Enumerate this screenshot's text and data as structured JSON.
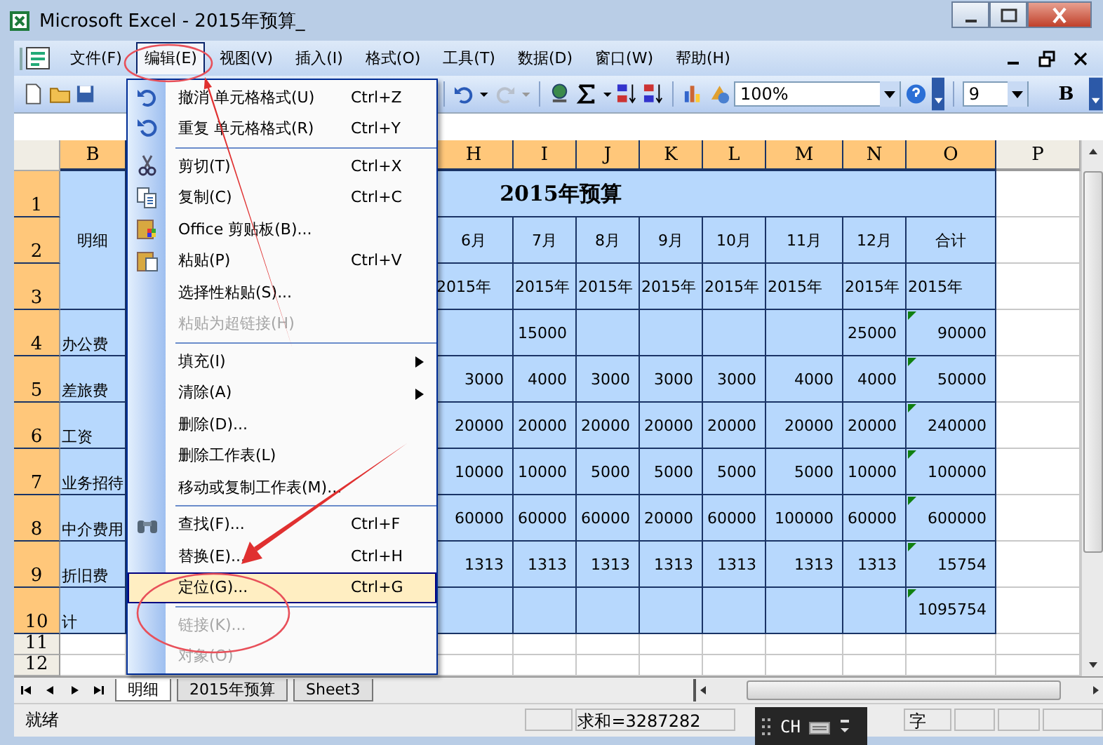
{
  "window": {
    "title": "Microsoft Excel - 2015年预算_"
  },
  "menu_bar": [
    {
      "label": "文件(F)",
      "selected": false
    },
    {
      "label": "编辑(E)",
      "selected": true
    },
    {
      "label": "视图(V)",
      "selected": false
    },
    {
      "label": "插入(I)",
      "selected": false
    },
    {
      "label": "格式(O)",
      "selected": false
    },
    {
      "label": "工具(T)",
      "selected": false
    },
    {
      "label": "数据(D)",
      "selected": false
    },
    {
      "label": "窗口(W)",
      "selected": false
    },
    {
      "label": "帮助(H)",
      "selected": false
    }
  ],
  "toolbar": {
    "zoom": "100%",
    "font_size": "9",
    "bold_label": "B",
    "redo_disabled": true
  },
  "columns": [
    {
      "label": "B",
      "selected": true
    },
    {
      "label": "H",
      "selected": true
    },
    {
      "label": "I",
      "selected": true
    },
    {
      "label": "J",
      "selected": true
    },
    {
      "label": "K",
      "selected": true
    },
    {
      "label": "L",
      "selected": true
    },
    {
      "label": "M",
      "selected": true
    },
    {
      "label": "N",
      "selected": true
    },
    {
      "label": "O",
      "selected": true
    },
    {
      "label": "P",
      "selected": false
    }
  ],
  "row_headers": [
    {
      "label": "1",
      "selected": true
    },
    {
      "label": "2",
      "selected": true
    },
    {
      "label": "3",
      "selected": true
    },
    {
      "label": "4",
      "selected": true
    },
    {
      "label": "5",
      "selected": true
    },
    {
      "label": "6",
      "selected": true
    },
    {
      "label": "7",
      "selected": true
    },
    {
      "label": "8",
      "selected": true
    },
    {
      "label": "9",
      "selected": true
    },
    {
      "label": "10",
      "selected": true
    },
    {
      "label": "11",
      "selected": false
    },
    {
      "label": "12",
      "selected": false
    }
  ],
  "sheet": {
    "title": "2015年预算",
    "detail_label": "明细",
    "months": [
      "6月",
      "7月",
      "8月",
      "9月",
      "10月",
      "11月",
      "12月",
      "合计"
    ],
    "years": [
      "2015年",
      "2015年",
      "2015年",
      "2015年",
      "2015年",
      "2015年",
      "2015年",
      "2015年"
    ],
    "rows": [
      {
        "name": "办公费",
        "error_mark": true,
        "cells": [
          {
            "kind": "blank"
          },
          {
            "kind": "number",
            "value": "15000"
          },
          {
            "kind": "blank"
          },
          {
            "kind": "blank"
          },
          {
            "kind": "blank"
          },
          {
            "kind": "blank"
          },
          {
            "kind": "number",
            "value": "25000"
          },
          {
            "kind": "number",
            "value": "90000"
          }
        ]
      },
      {
        "name": "差旅费",
        "error_mark": true,
        "cells": [
          {
            "kind": "number",
            "value": "3000"
          },
          {
            "kind": "number",
            "value": "4000"
          },
          {
            "kind": "number",
            "value": "3000"
          },
          {
            "kind": "number",
            "value": "3000"
          },
          {
            "kind": "number",
            "value": "3000"
          },
          {
            "kind": "number",
            "value": "4000"
          },
          {
            "kind": "number",
            "value": "4000"
          },
          {
            "kind": "number",
            "value": "50000"
          }
        ]
      },
      {
        "name": "工资",
        "error_mark": true,
        "cells": [
          {
            "kind": "number",
            "value": "20000"
          },
          {
            "kind": "number",
            "value": "20000"
          },
          {
            "kind": "number",
            "value": "20000"
          },
          {
            "kind": "number",
            "value": "20000"
          },
          {
            "kind": "number",
            "value": "20000"
          },
          {
            "kind": "number",
            "value": "20000"
          },
          {
            "kind": "number",
            "value": "20000"
          },
          {
            "kind": "number",
            "value": "240000"
          }
        ]
      },
      {
        "name": "业务招待",
        "error_mark": true,
        "cells": [
          {
            "kind": "number",
            "value": "10000"
          },
          {
            "kind": "number",
            "value": "10000"
          },
          {
            "kind": "number",
            "value": "5000"
          },
          {
            "kind": "number",
            "value": "5000"
          },
          {
            "kind": "number",
            "value": "5000"
          },
          {
            "kind": "number",
            "value": "5000"
          },
          {
            "kind": "number",
            "value": "10000"
          },
          {
            "kind": "number",
            "value": "100000"
          }
        ]
      },
      {
        "name": "中介费用",
        "error_mark": true,
        "cells": [
          {
            "kind": "number",
            "value": "60000"
          },
          {
            "kind": "number",
            "value": "60000"
          },
          {
            "kind": "number",
            "value": "60000"
          },
          {
            "kind": "number",
            "value": "20000"
          },
          {
            "kind": "number",
            "value": "60000"
          },
          {
            "kind": "number",
            "value": "100000"
          },
          {
            "kind": "number",
            "value": "60000"
          },
          {
            "kind": "number",
            "value": "600000"
          }
        ]
      },
      {
        "name": "折旧费",
        "error_mark": true,
        "cells": [
          {
            "kind": "number",
            "value": "1313"
          },
          {
            "kind": "number",
            "value": "1313"
          },
          {
            "kind": "number",
            "value": "1313"
          },
          {
            "kind": "number",
            "value": "1313"
          },
          {
            "kind": "number",
            "value": "1313"
          },
          {
            "kind": "number",
            "value": "1313"
          },
          {
            "kind": "number",
            "value": "1313"
          },
          {
            "kind": "number",
            "value": "15754"
          }
        ]
      },
      {
        "name": "计",
        "error_mark": true,
        "cells": [
          {
            "kind": "blank"
          },
          {
            "kind": "blank"
          },
          {
            "kind": "blank"
          },
          {
            "kind": "blank"
          },
          {
            "kind": "blank"
          },
          {
            "kind": "blank"
          },
          {
            "kind": "blank"
          },
          {
            "kind": "total",
            "value": "1095754"
          }
        ]
      }
    ]
  },
  "edit_menu": [
    {
      "kind": "item",
      "label": "撤消 单元格格式(U)",
      "shortcut": "Ctrl+Z",
      "disabled": false,
      "selected": false
    },
    {
      "kind": "item",
      "label": "重复 单元格格式(R)",
      "shortcut": "Ctrl+Y",
      "disabled": false,
      "selected": false
    },
    {
      "kind": "separator"
    },
    {
      "kind": "item",
      "label": "剪切(T)",
      "shortcut": "Ctrl+X",
      "disabled": false,
      "selected": false
    },
    {
      "kind": "item",
      "label": "复制(C)",
      "shortcut": "Ctrl+C",
      "disabled": false,
      "selected": false
    },
    {
      "kind": "item",
      "label": "Office 剪贴板(B)...",
      "disabled": false,
      "selected": false
    },
    {
      "kind": "item",
      "label": "粘贴(P)",
      "shortcut": "Ctrl+V",
      "disabled": false,
      "selected": false
    },
    {
      "kind": "item",
      "label": "选择性粘贴(S)...",
      "disabled": false,
      "selected": false
    },
    {
      "kind": "item",
      "label": "粘贴为超链接(H)",
      "disabled": true,
      "selected": false
    },
    {
      "kind": "separator"
    },
    {
      "kind": "submenu",
      "label": "填充(I)",
      "disabled": false,
      "selected": false
    },
    {
      "kind": "submenu",
      "label": "清除(A)",
      "disabled": false,
      "selected": false
    },
    {
      "kind": "item",
      "label": "删除(D)...",
      "disabled": false,
      "selected": false
    },
    {
      "kind": "item",
      "label": "删除工作表(L)",
      "disabled": false,
      "selected": false
    },
    {
      "kind": "item",
      "label": "移动或复制工作表(M)...",
      "disabled": false,
      "selected": false
    },
    {
      "kind": "separator"
    },
    {
      "kind": "item",
      "label": "查找(F)...",
      "shortcut": "Ctrl+F",
      "disabled": false,
      "selected": false
    },
    {
      "kind": "item",
      "label": "替换(E)...",
      "shortcut": "Ctrl+H",
      "disabled": false,
      "selected": false
    },
    {
      "kind": "item",
      "label": "定位(G)...",
      "shortcut": "Ctrl+G",
      "disabled": false,
      "selected": true
    },
    {
      "kind": "separator"
    },
    {
      "kind": "item",
      "label": "链接(K)...",
      "disabled": true,
      "selected": false
    },
    {
      "kind": "item",
      "label": "对象(O)",
      "disabled": true,
      "selected": false
    }
  ],
  "sheet_tabs": [
    {
      "label": "明细",
      "selected": true
    },
    {
      "label": "2015年预算",
      "selected": false
    },
    {
      "label": "Sheet3",
      "selected": false
    }
  ],
  "status_bar": {
    "state": "就绪",
    "sum": "求和=3287282",
    "mode": "字"
  },
  "ime_bar": {
    "label": "CH"
  }
}
